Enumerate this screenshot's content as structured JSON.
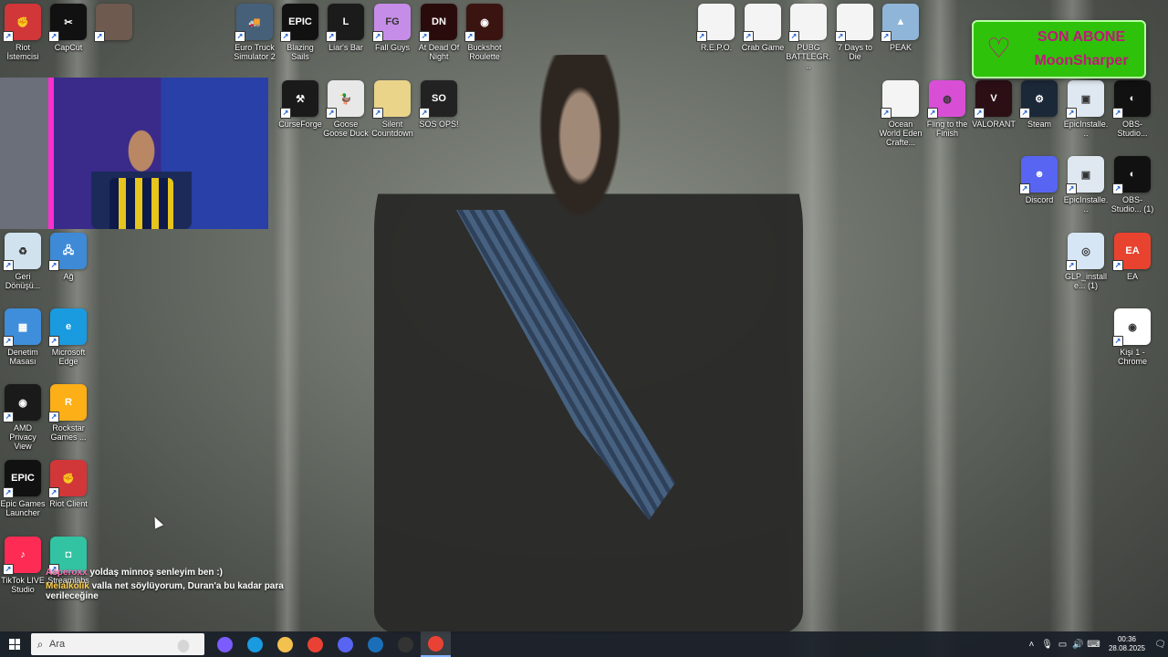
{
  "colors": {
    "badge_bg": "#2ec20b",
    "badge_text": "#c2177a",
    "chat_user1": "#ff6fb5",
    "chat_user2": "#ffd04a",
    "taskbar_bg": "#1a2028"
  },
  "desktop": {
    "icons": [
      {
        "id": "riot1",
        "label": "Riot İstemcisi",
        "color": "#d13639",
        "glyph": "✊"
      },
      {
        "id": "capcut",
        "label": "CapCut",
        "color": "#111111",
        "glyph": "✂"
      },
      {
        "id": "avatar",
        "label": "",
        "color": "#6e5a4e",
        "glyph": ""
      },
      {
        "id": "ets2",
        "label": "Euro Truck Simulator 2",
        "color": "#46607a",
        "glyph": "🚚"
      },
      {
        "id": "blazing",
        "label": "Blazing Sails",
        "color": "#111111",
        "glyph": "EPIC"
      },
      {
        "id": "liars",
        "label": "Liar's Bar",
        "color": "#1b1b1b",
        "glyph": "L"
      },
      {
        "id": "fallguys",
        "label": "Fall Guys",
        "color": "#c68de8",
        "glyph": "FG"
      },
      {
        "id": "deadofnight",
        "label": "At Dead Of Night",
        "color": "#2a0b0b",
        "glyph": "DN"
      },
      {
        "id": "buckshot",
        "label": "Buckshot Roulette",
        "color": "#3a1410",
        "glyph": "◉"
      },
      {
        "id": "repo",
        "label": "R.E.P.O.",
        "color": "#f4f4f4",
        "glyph": ""
      },
      {
        "id": "crab",
        "label": "Crab Game",
        "color": "#f4f4f4",
        "glyph": ""
      },
      {
        "id": "pubg",
        "label": "PUBG BATTLEGR...",
        "color": "#f4f4f4",
        "glyph": ""
      },
      {
        "id": "7days",
        "label": "7 Days to Die",
        "color": "#f4f4f4",
        "glyph": ""
      },
      {
        "id": "peak",
        "label": "PEAK",
        "color": "#8fb6d8",
        "glyph": "▲"
      },
      {
        "id": "curseforge",
        "label": "CurseForge",
        "color": "#1a1a1a",
        "glyph": "⚒"
      },
      {
        "id": "goose",
        "label": "Goose Goose Duck",
        "color": "#e8e8e8",
        "glyph": "🦆"
      },
      {
        "id": "silent",
        "label": "Silent Countdown",
        "color": "#e9d48a",
        "glyph": ""
      },
      {
        "id": "sosops",
        "label": "SOS OPS!",
        "color": "#222222",
        "glyph": "SO"
      },
      {
        "id": "ocean",
        "label": "Ocean World Eden Crafte...",
        "color": "#f4f4f4",
        "glyph": ""
      },
      {
        "id": "fling",
        "label": "Fling to the Finish",
        "color": "#d84fd6",
        "glyph": "◍"
      },
      {
        "id": "valorant",
        "label": "VALORANT",
        "color": "#2b0f15",
        "glyph": "V"
      },
      {
        "id": "steam",
        "label": "Steam",
        "color": "#1b2838",
        "glyph": "⚙"
      },
      {
        "id": "epicinst1",
        "label": "EpicInstalle...",
        "color": "#dfe8f0",
        "glyph": "▣"
      },
      {
        "id": "obs1",
        "label": "OBS-Studio...",
        "color": "#111111",
        "glyph": "◐"
      },
      {
        "id": "discord",
        "label": "Discord",
        "color": "#5865f2",
        "glyph": "☻"
      },
      {
        "id": "epicinst2",
        "label": "EpicInstalle...",
        "color": "#dfe8f0",
        "glyph": "▣"
      },
      {
        "id": "obs2",
        "label": "OBS-Studio... (1)",
        "color": "#111111",
        "glyph": "◐"
      },
      {
        "id": "glp",
        "label": "GLP_installe... (1)",
        "color": "#d7e6f4",
        "glyph": "◎"
      },
      {
        "id": "ea",
        "label": "EA",
        "color": "#e8432f",
        "glyph": "EA"
      },
      {
        "id": "chrome",
        "label": "Kişi 1 - Chrome",
        "color": "#ffffff",
        "glyph": "◉"
      },
      {
        "id": "recycle",
        "label": "Geri Dönüşü...",
        "color": "#cfe2ee",
        "glyph": "♻"
      },
      {
        "id": "network",
        "label": "Ağ",
        "color": "#3e8ad6",
        "glyph": "🖧"
      },
      {
        "id": "control",
        "label": "Denetim Masası",
        "color": "#3f8edb",
        "glyph": "▦"
      },
      {
        "id": "edge",
        "label": "Microsoft Edge",
        "color": "#1a9be0",
        "glyph": "e"
      },
      {
        "id": "amd",
        "label": "AMD Privacy View",
        "color": "#1a1a1a",
        "glyph": "◉"
      },
      {
        "id": "rockstar",
        "label": "Rockstar Games ...",
        "color": "#fcaf17",
        "glyph": "R"
      },
      {
        "id": "epic",
        "label": "Epic Games Launcher",
        "color": "#111111",
        "glyph": "EPIC"
      },
      {
        "id": "riot2",
        "label": "Riot Client",
        "color": "#d13639",
        "glyph": "✊"
      },
      {
        "id": "tiktok",
        "label": "TikTok LIVE Studio",
        "color": "#fe2c55",
        "glyph": "♪"
      },
      {
        "id": "streamlabs",
        "label": "Streamlabs",
        "color": "#31c3a2",
        "glyph": "◘"
      }
    ]
  },
  "overlay": {
    "sub_line1": "SON ABONE",
    "sub_line2": "MoonSharper",
    "chat": [
      {
        "user": "Asperoxx",
        "text": "yoldaş minnoş senleyim ben :)"
      },
      {
        "user": "Melalkolik",
        "text": "valla net söylüyorum, Duran'a bu kadar para verileceğine"
      }
    ]
  },
  "taskbar": {
    "search_placeholder": "Ara",
    "apps": [
      {
        "id": "copilot",
        "color": "#7a5cff"
      },
      {
        "id": "edge",
        "color": "#1a9be0"
      },
      {
        "id": "explorer",
        "color": "#f2c14e"
      },
      {
        "id": "chrome",
        "color": "#e94235"
      },
      {
        "id": "discord",
        "color": "#5865f2"
      },
      {
        "id": "steam",
        "color": "#1b6fb8"
      },
      {
        "id": "obs",
        "color": "#333333"
      },
      {
        "id": "chrome2",
        "color": "#e94235"
      }
    ],
    "time": "00:36",
    "date": "28.08.2025"
  }
}
